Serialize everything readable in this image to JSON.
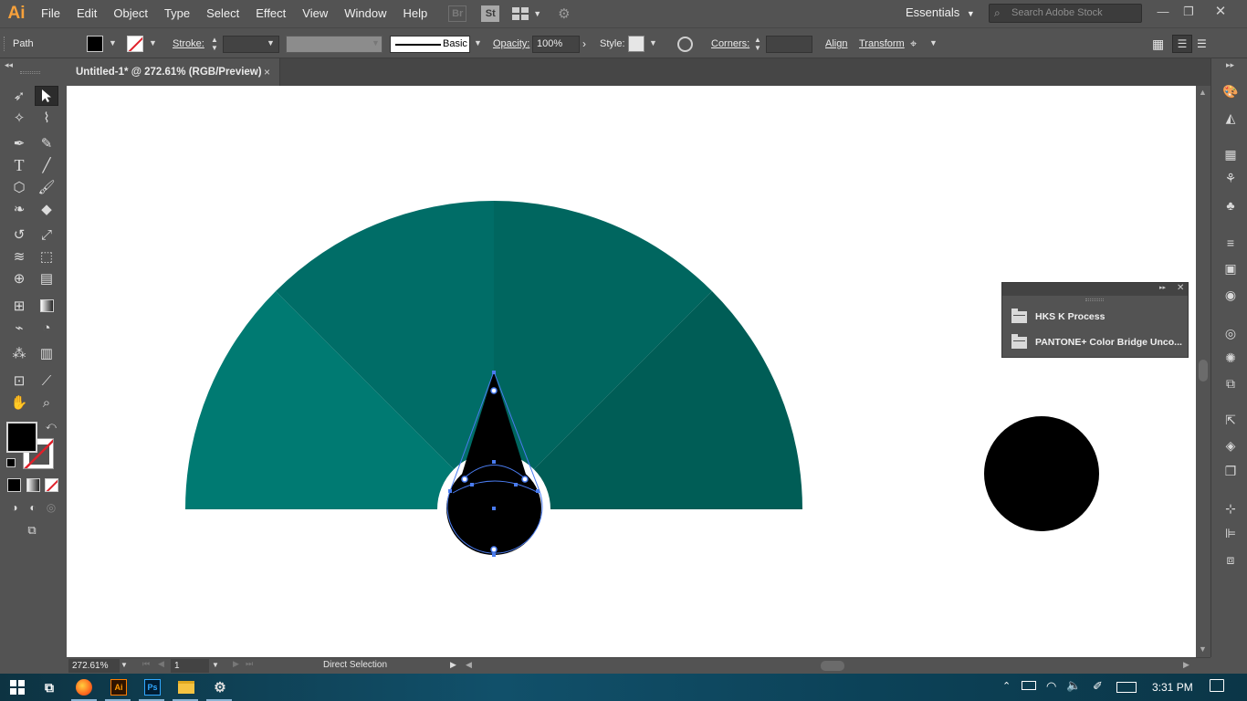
{
  "app": {
    "logo": "Ai",
    "menu": [
      "File",
      "Edit",
      "Object",
      "Type",
      "Select",
      "Effect",
      "View",
      "Window",
      "Help"
    ],
    "bridge_label": "Br",
    "stock_label": "St",
    "workspace": "Essentials",
    "search_placeholder": "Search Adobe Stock",
    "window_controls": [
      "minimize-icon",
      "restore-icon",
      "close-icon"
    ]
  },
  "control_bar": {
    "selection_type": "Path",
    "fill_color": "#000000",
    "stroke_label": "Stroke:",
    "brush_label": "Basic",
    "opacity_label": "Opacity:",
    "opacity_value": "100%",
    "style_label": "Style:",
    "corners_label": "Corners:",
    "align_label": "Align",
    "transform_label": "Transform"
  },
  "document": {
    "tab_title": "Untitled-1* @ 272.61% (RGB/Preview)",
    "tab_close": "×"
  },
  "artwork": {
    "segment_colors": [
      "#007a72",
      "#006d67",
      "#00665f",
      "#005d56"
    ],
    "needle_color": "#000000",
    "selection_color": "#4a7cf0",
    "circle_color": "#000000"
  },
  "libraries_panel": {
    "items": [
      "HKS K Process",
      "PANTONE+ Color Bridge Unco..."
    ]
  },
  "status_bar": {
    "zoom": "272.61%",
    "artboard": "1",
    "tool": "Direct Selection"
  },
  "taskbar": {
    "time": "3:31 PM",
    "apps": [
      "windows-start-icon",
      "task-view-icon",
      "firefox-icon",
      "illustrator-icon",
      "photoshop-icon",
      "file-explorer-icon",
      "app-icon"
    ],
    "ai_label": "Ai",
    "ps_label": "Ps"
  }
}
